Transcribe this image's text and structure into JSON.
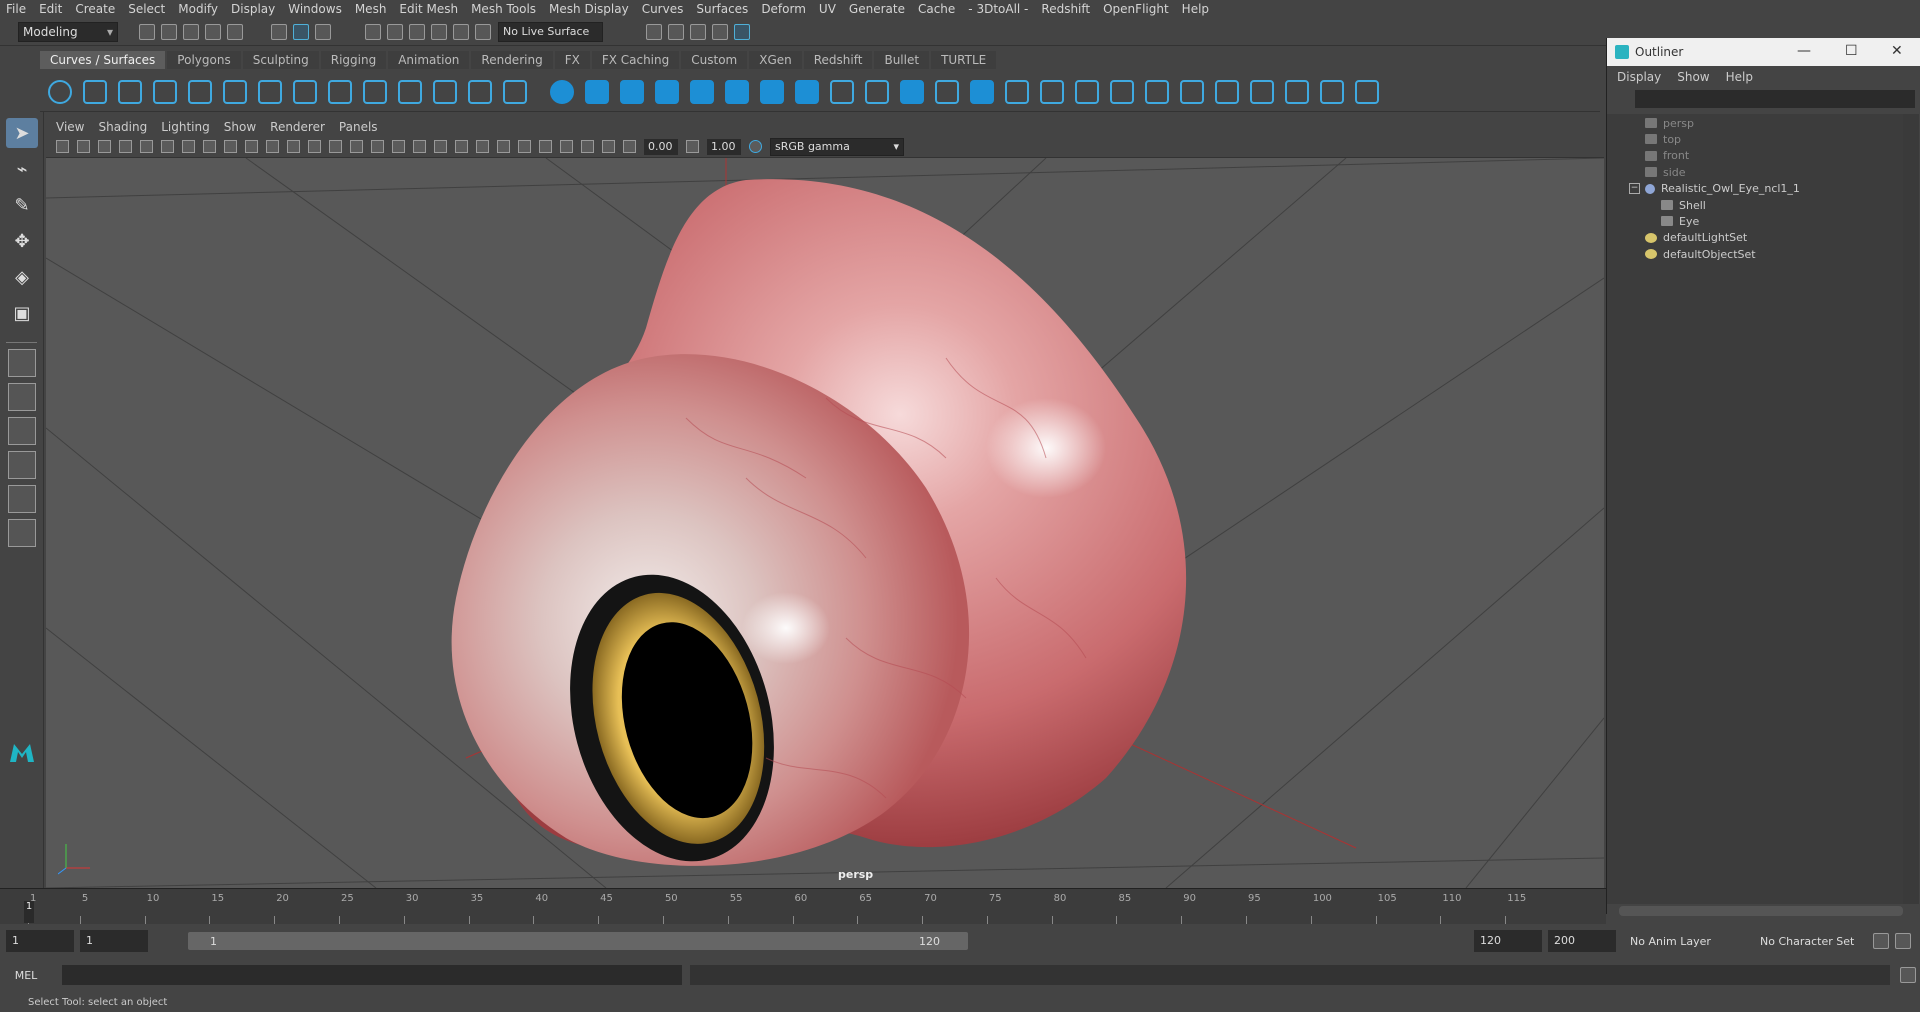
{
  "menubar": [
    "File",
    "Edit",
    "Create",
    "Select",
    "Modify",
    "Display",
    "Windows",
    "Mesh",
    "Edit Mesh",
    "Mesh Tools",
    "Mesh Display",
    "Curves",
    "Surfaces",
    "Deform",
    "UV",
    "Generate",
    "Cache",
    "- 3DtoAll -",
    "Redshift",
    "OpenFlight",
    "Help"
  ],
  "status": {
    "mode": "Modeling",
    "live_surface": "No Live Surface"
  },
  "shelf_tabs": [
    "Curves / Surfaces",
    "Polygons",
    "Sculpting",
    "Rigging",
    "Animation",
    "Rendering",
    "FX",
    "FX Caching",
    "Custom",
    "XGen",
    "Redshift",
    "Bullet",
    "TURTLE"
  ],
  "shelf_active": "Curves / Surfaces",
  "viewport": {
    "menu": [
      "View",
      "Shading",
      "Lighting",
      "Show",
      "Renderer",
      "Panels"
    ],
    "exposure": "0.00",
    "gamma_value": "1.00",
    "color_space": "sRGB gamma",
    "camera_label": "persp"
  },
  "outliner": {
    "title": "Outliner",
    "menu": [
      "Display",
      "Show",
      "Help"
    ],
    "items": [
      {
        "label": "persp",
        "type": "camera",
        "dim": true
      },
      {
        "label": "top",
        "type": "camera",
        "dim": true
      },
      {
        "label": "front",
        "type": "camera",
        "dim": true
      },
      {
        "label": "side",
        "type": "camera",
        "dim": true
      },
      {
        "label": "Realistic_Owl_Eye_ncl1_1",
        "type": "group",
        "dim": false
      },
      {
        "label": "Shell",
        "type": "mesh",
        "dim": false
      },
      {
        "label": "Eye",
        "type": "mesh",
        "dim": false
      },
      {
        "label": "defaultLightSet",
        "type": "set",
        "dim": false
      },
      {
        "label": "defaultObjectSet",
        "type": "set",
        "dim": false
      }
    ]
  },
  "timeline": {
    "ticks": [
      "1",
      "5",
      "10",
      "15",
      "20",
      "25",
      "30",
      "35",
      "40",
      "45",
      "50",
      "55",
      "60",
      "65",
      "70",
      "75",
      "80",
      "85",
      "90",
      "95",
      "100",
      "105",
      "110",
      "115"
    ],
    "current_frame": "1"
  },
  "range": {
    "start": "1",
    "playback_start": "1",
    "slider_start": "1",
    "slider_end": "120",
    "playback_end": "120",
    "end": "200",
    "anim_layer": "No Anim Layer",
    "character_set": "No Character Set"
  },
  "command": {
    "lang": "MEL"
  },
  "help_line": "Select Tool: select an object",
  "colors": {
    "accent": "#3fa9e0",
    "viewport_bg": "#585858",
    "panel": "#444444"
  }
}
